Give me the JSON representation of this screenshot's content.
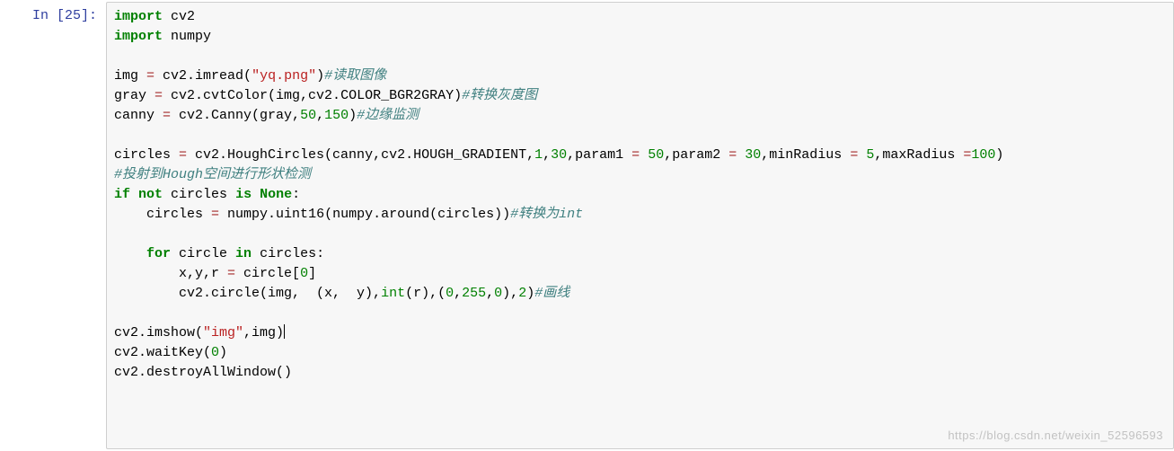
{
  "prompt": {
    "label": "In ",
    "number": "[25]:"
  },
  "code": {
    "kw_import1": "import",
    "mod_cv2": " cv2",
    "kw_import2": "import",
    "mod_numpy": " numpy",
    "l4_a": "img ",
    "op_eq": "=",
    "l4_b": " cv2.imread(",
    "str_yq": "\"yq.png\"",
    "l4_c": ")",
    "cmt_read": "#读取图像",
    "l5_a": "gray ",
    "l5_b": " cv2.cvtColor(img,cv2.COLOR_BGR2GRAY)",
    "cmt_gray": "#转换灰度图",
    "l6_a": "canny ",
    "l6_b": " cv2.Canny(gray,",
    "n50": "50",
    "comma": ",",
    "n150": "150",
    "l6_c": ")",
    "cmt_canny": "#边缘监测",
    "l8_a": "circles ",
    "l8_b": " cv2.HoughCircles(canny,cv2.HOUGH_GRADIENT,",
    "n1": "1",
    "n30": "30",
    "l8_p1": ",param1 ",
    "l8_p2": ",param2 ",
    "l8_minR": ",minRadius ",
    "n5": "5",
    "l8_maxR": ",maxRadius ",
    "n100": "100",
    "l8_c": ")",
    "cmt_hough": "#投射到Hough空间进行形状检测",
    "kw_if": "if",
    "kw_not": "not",
    "l10_a": " circles ",
    "kw_is": "is",
    "kw_none": "None",
    "colon": ":",
    "l11_a": "    circles ",
    "l11_b": " numpy.uint16(numpy.around(circles))",
    "cmt_int": "#转换为int",
    "kw_for": "for",
    "l13_a": " circle ",
    "kw_in": "in",
    "l13_b": " circles:",
    "l14_a": "        x,y,r ",
    "l14_b": " circle[",
    "n0": "0",
    "l14_c": "]",
    "l15_a": "        cv2.circle(img,  (x,  y),",
    "bi_int": "int",
    "l15_b": "(r),(",
    "n255": "255",
    "l15_c": "),",
    "n2": "2",
    "l15_d": ")",
    "cmt_draw": "#画线",
    "l17_a": "cv2.imshow(",
    "str_img": "\"img\"",
    "l17_b": ",img)",
    "l18_a": "cv2.waitKey(",
    "l18_b": ")",
    "l19_a": "cv2.destroyAllWindow()",
    "sp": " ",
    "sp4": "    "
  },
  "watermark": "https://blog.csdn.net/weixin_52596593"
}
